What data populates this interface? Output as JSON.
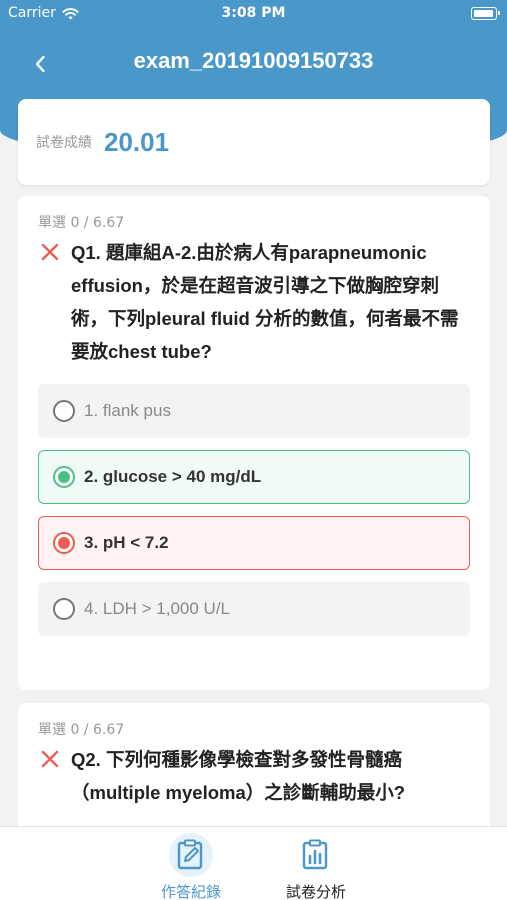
{
  "status_bar": {
    "carrier": "Carrier",
    "time": "3:08 PM"
  },
  "nav": {
    "title": "exam_20191009150733"
  },
  "score": {
    "label": "試卷成績",
    "value": "20.01"
  },
  "questions": [
    {
      "type_label": "單選 0 / 6.67",
      "text": "Q1. 題庫組A-2.由於病人有parapneumonic effusion，於是在超音波引導之下做胸腔穿刺術，下列pleural fluid 分析的數值，何者最不需要放chest tube?",
      "result": "wrong",
      "options": [
        {
          "label": "1. flank pus",
          "state": "normal"
        },
        {
          "label": "2. glucose > 40 mg/dL",
          "state": "correct"
        },
        {
          "label": "3. pH < 7.2",
          "state": "selected-wrong"
        },
        {
          "label": "4. LDH > 1,000 U/L",
          "state": "normal"
        }
      ]
    },
    {
      "type_label": "單選 0 / 6.67",
      "text": "Q2. 下列何種影像學檢查對多發性骨髓癌（multiple myeloma）之診斷輔助最小?",
      "result": "wrong"
    }
  ],
  "tabs": [
    {
      "label": "作答紀錄",
      "icon": "edit-clipboard-icon",
      "active": true
    },
    {
      "label": "試卷分析",
      "icon": "bar-chart-clipboard-icon",
      "active": false
    }
  ],
  "colors": {
    "primary": "#4a98c9",
    "correct": "#4cbf88",
    "wrong": "#ee5c51"
  }
}
